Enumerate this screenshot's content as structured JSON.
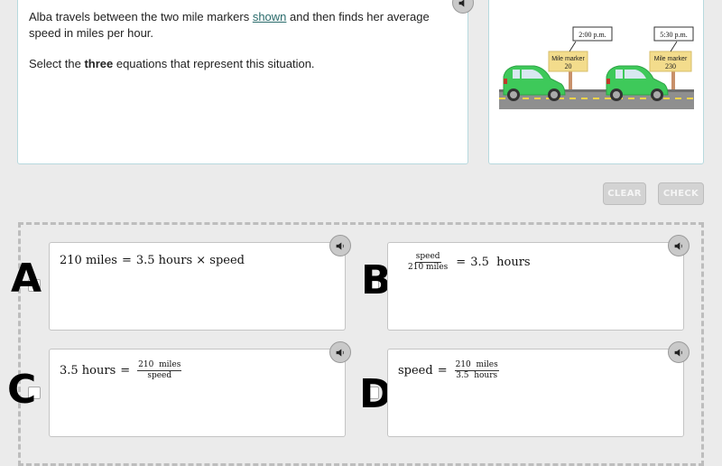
{
  "question": {
    "text_part1": "Alba travels between the two mile markers ",
    "link_text": "shown",
    "text_part2": " and then finds her average speed in miles per hour.",
    "instruction_prefix": "Select the ",
    "instruction_bold": "three",
    "instruction_suffix": " equations that represent this situation."
  },
  "illustration": {
    "marker1": {
      "time": "2:00 p.m.",
      "label": "Mile marker",
      "number": "20"
    },
    "marker2": {
      "time": "5:30 p.m.",
      "label": "Mile marker",
      "number": "230"
    },
    "car_color": "#3ec95a"
  },
  "buttons": {
    "clear": "CLEAR",
    "check": "CHECK"
  },
  "options": [
    {
      "letter": "A",
      "lhs": "210 miles",
      "eq": "=",
      "rhs": "3.5 hours × speed"
    },
    {
      "letter": "B",
      "num": "speed",
      "den": "210  miles",
      "eq": "=",
      "rhs": "3.5  hours"
    },
    {
      "letter": "C",
      "lhs": "3.5 hours",
      "eq": "=",
      "num": "210  miles",
      "den": "speed"
    },
    {
      "letter": "D",
      "lhs": "speed",
      "eq": "=",
      "num": "210  miles",
      "den": "3.5  hours"
    }
  ]
}
